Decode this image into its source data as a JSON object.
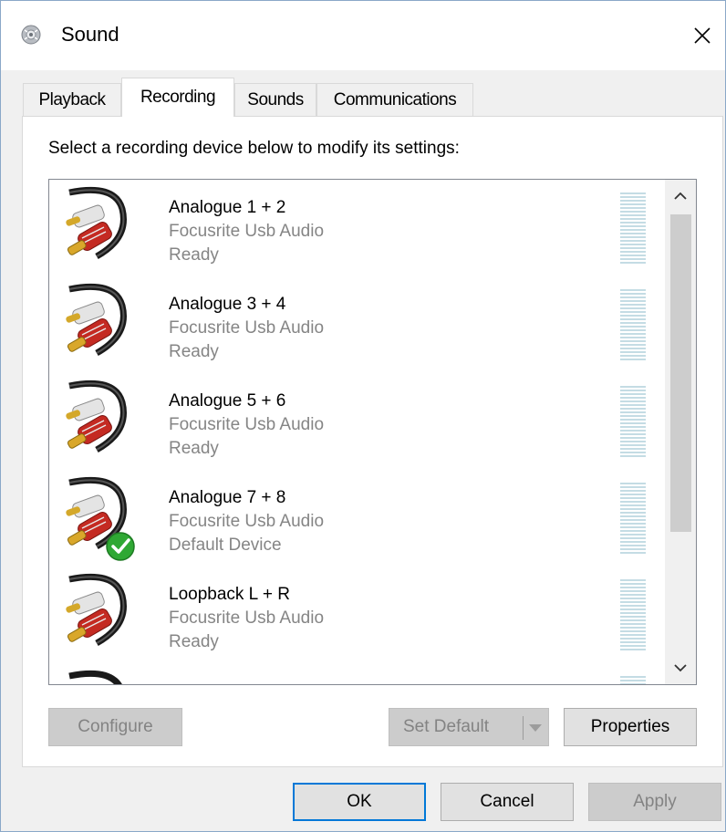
{
  "window": {
    "title": "Sound"
  },
  "tabs": [
    {
      "label": "Playback"
    },
    {
      "label": "Recording"
    },
    {
      "label": "Sounds"
    },
    {
      "label": "Communications"
    }
  ],
  "instruction": "Select a recording device below to modify its settings:",
  "devices": [
    {
      "name": "Analogue 1 + 2",
      "driver": "Focusrite Usb Audio",
      "status": "Ready",
      "is_default": false
    },
    {
      "name": "Analogue 3 + 4",
      "driver": "Focusrite Usb Audio",
      "status": "Ready",
      "is_default": false
    },
    {
      "name": "Analogue 5 + 6",
      "driver": "Focusrite Usb Audio",
      "status": "Ready",
      "is_default": false
    },
    {
      "name": "Analogue 7 + 8",
      "driver": "Focusrite Usb Audio",
      "status": "Default Device",
      "is_default": true
    },
    {
      "name": "Loopback L + R",
      "driver": "Focusrite Usb Audio",
      "status": "Ready",
      "is_default": false
    }
  ],
  "buttons": {
    "configure": "Configure",
    "set_default": "Set Default",
    "properties": "Properties",
    "ok": "OK",
    "cancel": "Cancel",
    "apply": "Apply"
  },
  "icons": {
    "app": "speaker-icon",
    "close": "close-icon",
    "device": "rca-cable-icon",
    "default_badge": "green-check-icon"
  },
  "colors": {
    "accent": "#0078d7",
    "level_meter": "#c4dce4",
    "default_check": "#2fa834"
  }
}
